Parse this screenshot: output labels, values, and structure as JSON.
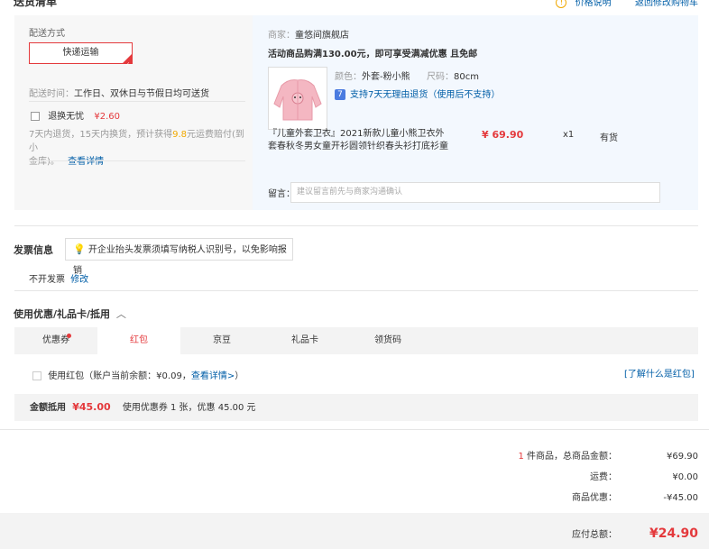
{
  "header": {
    "title": "送货清单",
    "price_note": "价格说明",
    "back_cart": "返回修改购物车"
  },
  "shipping": {
    "method_label": "配送方式",
    "method_value": "快递运输",
    "time_label": "配送时间：",
    "time_value": "工作日、双休日与节假日均可送货",
    "return_free_label": "退换无忧",
    "return_free_price": "¥2.60",
    "return_desc_1": "7天内退货，15天内换货，预计获得",
    "return_desc_amount": "9.8",
    "return_desc_2": "元运费赔付(到小",
    "return_desc_3": "金库)。",
    "return_detail_link": "查看详情"
  },
  "shop": {
    "merchant_label": "商家：",
    "merchant_name": "童悠间旗舰店",
    "promo": "活动商品购满130.00元，即可享受满减优惠 且免邮",
    "color_label": "颜色：",
    "color_value": "外套-粉小熊",
    "size_label": "尺码：",
    "size_value": "80cm",
    "guarantee_icon": "7",
    "guarantee_text": "支持7天无理由退货（使用后不支持）",
    "product_title_1": "『儿童外套卫衣』2021新款儿童小熊卫衣外",
    "product_title_2": "套春秋冬男女童开衫圆领针织春头衫打底衫童",
    "price": "¥ 69.90",
    "quantity": "x1",
    "stock": "有货",
    "message_label": "留言：",
    "message_placeholder": "建议留言前先与商家沟通确认"
  },
  "invoice": {
    "title": "发票信息",
    "tip": "开企业抬头发票须填写纳税人识别号，以免影响报销",
    "status": "不开发票",
    "modify": "修改"
  },
  "coupon": {
    "title": "使用优惠/礼品卡/抵用",
    "tabs": [
      "优惠券",
      "红包",
      "京豆",
      "礼品卡",
      "领货码"
    ],
    "redpacket_label": "使用红包（账户当前余额：¥0.09，",
    "redpacket_link": "查看详情>",
    "redpacket_close": "）",
    "learn_redpacket": "[了解什么是红包]",
    "deduct_label": "金额抵用",
    "deduct_amount": "¥45.00",
    "deduct_desc": "使用优惠券 1 张，优惠 45.00 元"
  },
  "summary": {
    "count": "1",
    "count_label": "件商品，总商品金额：",
    "total_goods": "¥69.90",
    "freight_label": "运费：",
    "freight": "¥0.00",
    "discount_label": "商品优惠：",
    "discount": "-¥45.00",
    "payable_label": "应付总额：",
    "payable": "¥24.90"
  },
  "colors": {
    "accent": "#e4393c",
    "link": "#005ea7",
    "panel": "#f7f7f7",
    "panel_blue": "#f3f8fe"
  }
}
